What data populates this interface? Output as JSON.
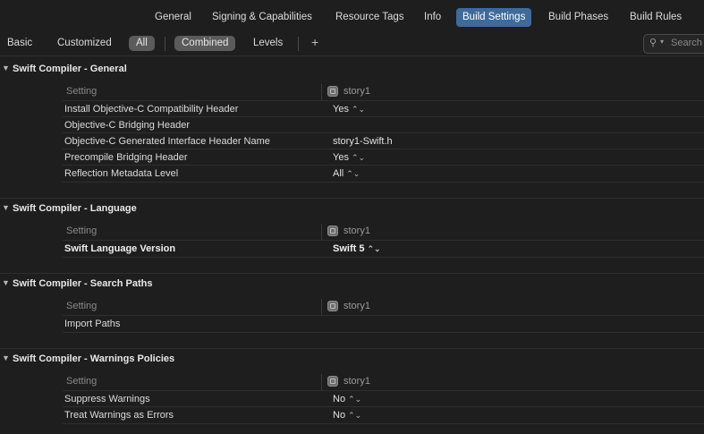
{
  "tabs": [
    {
      "label": "General"
    },
    {
      "label": "Signing & Capabilities"
    },
    {
      "label": "Resource Tags"
    },
    {
      "label": "Info"
    },
    {
      "label": "Build Settings"
    },
    {
      "label": "Build Phases"
    },
    {
      "label": "Build Rules"
    }
  ],
  "filters": {
    "basic": "Basic",
    "customized": "Customized",
    "all": "All",
    "combined": "Combined",
    "levels": "Levels",
    "add": "+"
  },
  "search": {
    "placeholder": "Search",
    "icon": "search-icon"
  },
  "target_name": "story1",
  "header_label": "Setting",
  "sections": [
    {
      "title": "Swift Compiler - General",
      "rows": [
        {
          "name": "Install Objective-C Compatibility Header",
          "value": "Yes"
        },
        {
          "name": "Objective-C Bridging Header",
          "value": ""
        },
        {
          "name": "Objective-C Generated Interface Header Name",
          "value": "story1-Swift.h"
        },
        {
          "name": "Precompile Bridging Header",
          "value": "Yes"
        },
        {
          "name": "Reflection Metadata Level",
          "value": "All"
        }
      ]
    },
    {
      "title": "Swift Compiler - Language",
      "rows": [
        {
          "name": "Swift Language Version",
          "value": "Swift 5"
        }
      ]
    },
    {
      "title": "Swift Compiler - Search Paths",
      "rows": [
        {
          "name": "Import Paths",
          "value": ""
        }
      ]
    },
    {
      "title": "Swift Compiler - Warnings Policies",
      "rows": [
        {
          "name": "Suppress Warnings",
          "value": "No"
        },
        {
          "name": "Treat Warnings as Errors",
          "value": "No"
        }
      ]
    }
  ],
  "stepper_glyph": "⌃⌄",
  "colors": {
    "background": "#1e1e1e",
    "active_tab": "#3f6a9a",
    "selected_filter": "#5b5b5b"
  }
}
